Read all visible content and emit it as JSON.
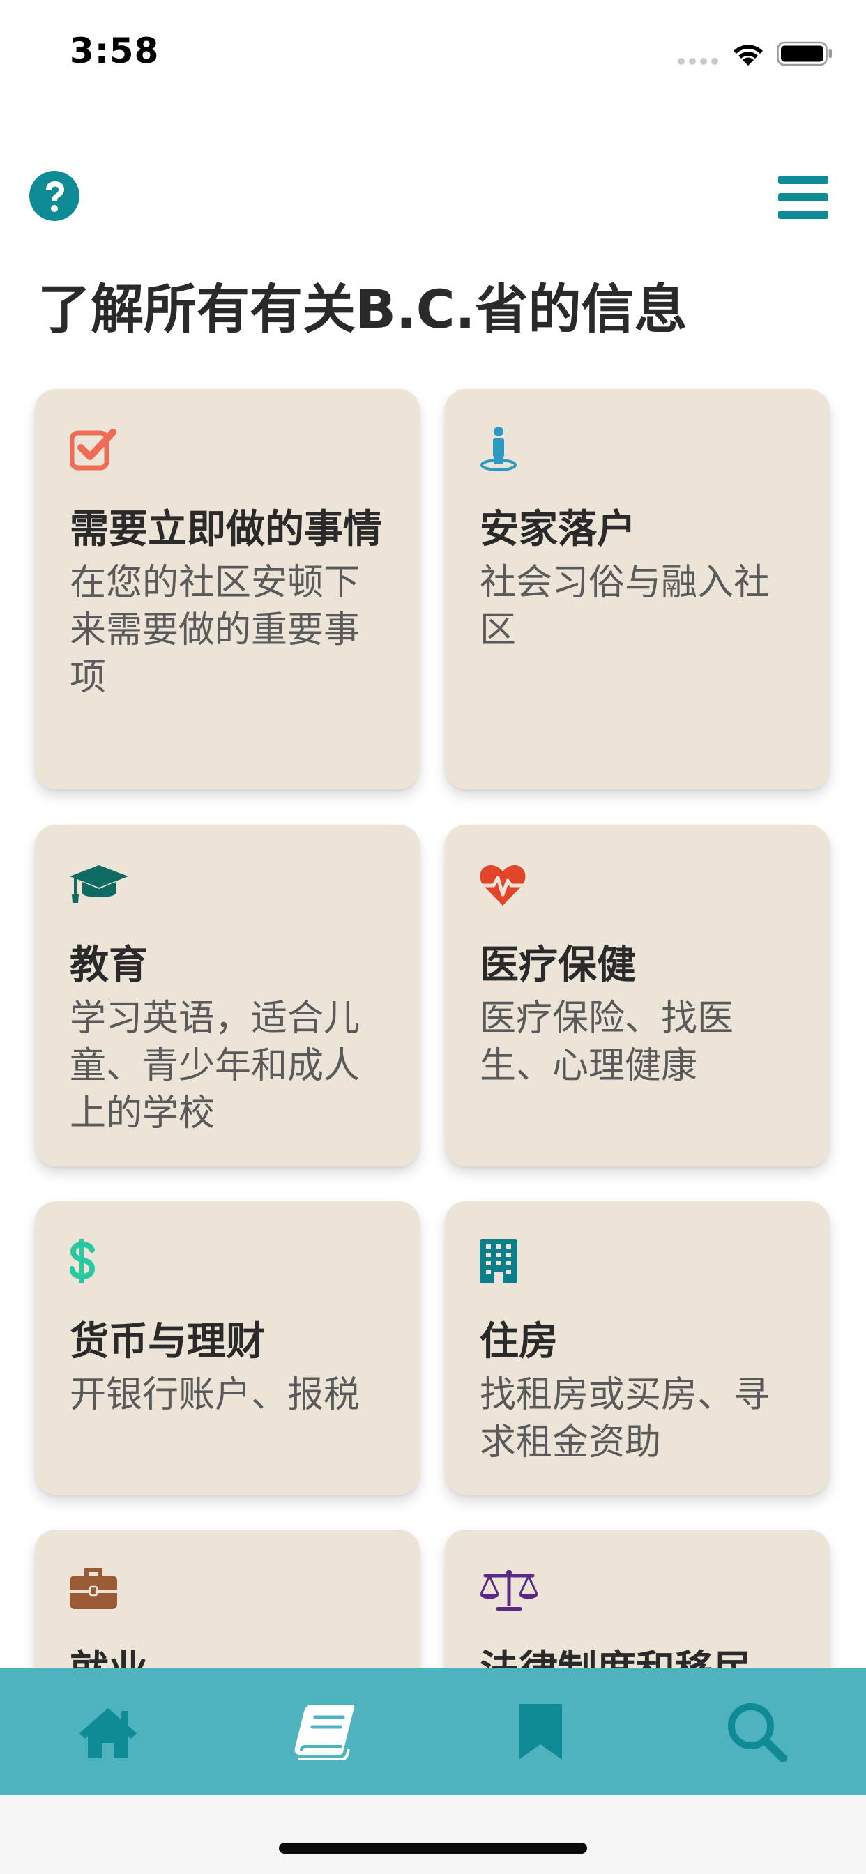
{
  "status_bar": {
    "time": "3:58"
  },
  "header": {
    "help_icon": "question-circle",
    "menu_icon": "hamburger-menu",
    "title": "了解所有有关B.C.省的信息"
  },
  "colors": {
    "accent": "#0e8b95",
    "card_background": "#ede4d8",
    "tab_bar_background": "#4eb3be",
    "tab_icon": "#0e8b95",
    "check_icon": "#ef6b55",
    "person_icon": "#2b9bc4",
    "education_icon": "#0e6b63",
    "health_icon": "#e2452a",
    "money_icon": "#27c9a2",
    "housing_icon": "#0e7f8a",
    "briefcase_icon": "#9a5a36",
    "scales_icon": "#5b2a86"
  },
  "cards": [
    {
      "icon": "check-square-icon",
      "title": "需要立即做的事情",
      "desc": "在您的社区安顿下来需要做的重要事项"
    },
    {
      "icon": "person-location-icon",
      "title": "安家落户",
      "desc": "社会习俗与融入社区"
    },
    {
      "icon": "graduation-cap-icon",
      "title": "教育",
      "desc": "学习英语，适合儿童、青少年和成人上的学校"
    },
    {
      "icon": "heartbeat-icon",
      "title": "医疗保健",
      "desc": "医疗保险、找医生、心理健康"
    },
    {
      "icon": "dollar-icon",
      "title": "货币与理财",
      "desc": "开银行账户、报税"
    },
    {
      "icon": "building-icon",
      "title": "住房",
      "desc": "找租房或买房、寻求租金资助"
    },
    {
      "icon": "briefcase-icon",
      "title": "就业",
      "desc": ""
    },
    {
      "icon": "scales-icon",
      "title": "法律制度和移民",
      "desc": ""
    }
  ],
  "tab_bar": {
    "tabs": [
      {
        "name": "home",
        "icon": "home-icon"
      },
      {
        "name": "learn",
        "icon": "book-icon"
      },
      {
        "name": "bookmarks",
        "icon": "bookmark-icon"
      },
      {
        "name": "search",
        "icon": "search-icon"
      }
    ]
  }
}
